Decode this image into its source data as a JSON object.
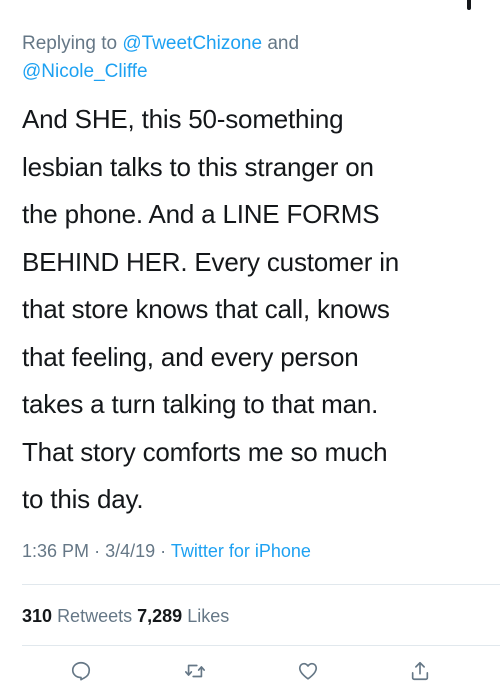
{
  "reply": {
    "prefix": "Replying to",
    "user1": "@TweetChizone",
    "conjunction": "and",
    "user2": "@Nicole_Cliffe"
  },
  "tweet": {
    "lines": [
      "And SHE, this 50-something",
      "lesbian talks to this stranger on",
      "the phone. And a LINE FORMS",
      "BEHIND HER. Every customer in",
      "that store knows that call, knows",
      "that feeling, and every person",
      "takes a turn talking to that man.",
      "That story comforts me so much",
      "to this day."
    ]
  },
  "meta": {
    "time": "1:36 PM",
    "sep1": "·",
    "date": "3/4/19",
    "sep2": "·",
    "source": "Twitter for iPhone"
  },
  "stats": {
    "retweets_count": "310",
    "retweets_label": "Retweets",
    "likes_count": "7,289",
    "likes_label": "Likes"
  },
  "actions": {
    "reply_icon": "reply-icon",
    "retweet_icon": "retweet-icon",
    "like_icon": "like-icon",
    "share_icon": "share-icon"
  }
}
